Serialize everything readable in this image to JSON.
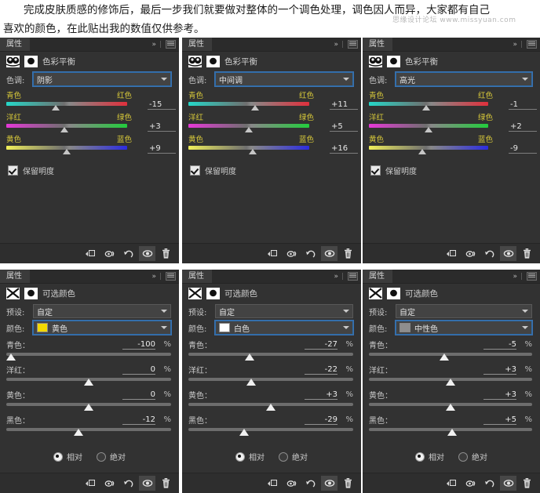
{
  "intro": {
    "line1": "完成皮肤质感的修饰后，最后一步我们就要做对整体的一个调色处理，调色因人而异，大家都有自己",
    "line2": "喜欢的颜色，在此贴出我的数值仅供参考。",
    "watermark": "思缘设计论坛  www.missyuan.com"
  },
  "panel_chrome": {
    "tab_label": "属性",
    "collapse_icon": "chevron-double-right-icon",
    "menu_icon": "panel-menu-icon"
  },
  "footer_buttons": [
    {
      "name": "clip-to-layer-button",
      "icon": "clip-to-layer-icon"
    },
    {
      "name": "view-previous-state-button",
      "icon": "eye-previous-icon"
    },
    {
      "name": "reset-button",
      "icon": "reset-arrow-icon"
    },
    {
      "name": "toggle-visibility-button",
      "icon": "eye-icon",
      "active": true
    },
    {
      "name": "delete-button",
      "icon": "trash-icon"
    }
  ],
  "color_balance": {
    "title": "色彩平衡",
    "adjust_icon": "color-balance-icon",
    "mask_icon": "layer-mask-icon",
    "tone_label": "色调:",
    "preserve_luminosity_label": "保留明度",
    "channels": [
      {
        "left": "青色",
        "right": "红色"
      },
      {
        "left": "洋红",
        "right": "绿色"
      },
      {
        "left": "黄色",
        "right": "蓝色"
      }
    ],
    "panels": [
      {
        "tone": "阴影",
        "values": [
          "-15",
          "+3",
          "+9"
        ],
        "positions": [
          41,
          48,
          50
        ],
        "preserve_luminosity": true
      },
      {
        "tone": "中间调",
        "values": [
          "+11",
          "+5",
          "+16"
        ],
        "positions": [
          55,
          50,
          53
        ],
        "preserve_luminosity": true
      },
      {
        "tone": "高光",
        "values": [
          "-1",
          "+2",
          "-9"
        ],
        "positions": [
          48,
          50,
          45
        ],
        "preserve_luminosity": true
      }
    ]
  },
  "selective_color": {
    "title": "可选颜色",
    "adjust_icon": "selective-color-icon",
    "mask_icon": "layer-mask-icon",
    "preset_label": "预设:",
    "preset_value": "自定",
    "colors_label": "颜色:",
    "percent_sign": "%",
    "channels": [
      "青色：",
      "洋红：",
      "黄色：",
      "黑色："
    ],
    "method_relative": "相对",
    "method_absolute": "绝对",
    "panels": [
      {
        "color_value": "黄色",
        "swatch": "#f2d900",
        "values": [
          "-100",
          "0",
          "0",
          "-12"
        ],
        "positions": [
          3,
          50,
          50,
          44
        ],
        "method": "relative"
      },
      {
        "color_value": "白色",
        "swatch": "#ffffff",
        "values": [
          "-27",
          "-22",
          "+3",
          "-29"
        ],
        "positions": [
          37,
          38,
          50,
          34
        ],
        "method": "relative"
      },
      {
        "color_value": "中性色",
        "swatch": "#8e8e8e",
        "values": [
          "-5",
          "+3",
          "+3",
          "+5"
        ],
        "positions": [
          46,
          50,
          50,
          51
        ],
        "method": "relative"
      }
    ]
  }
}
